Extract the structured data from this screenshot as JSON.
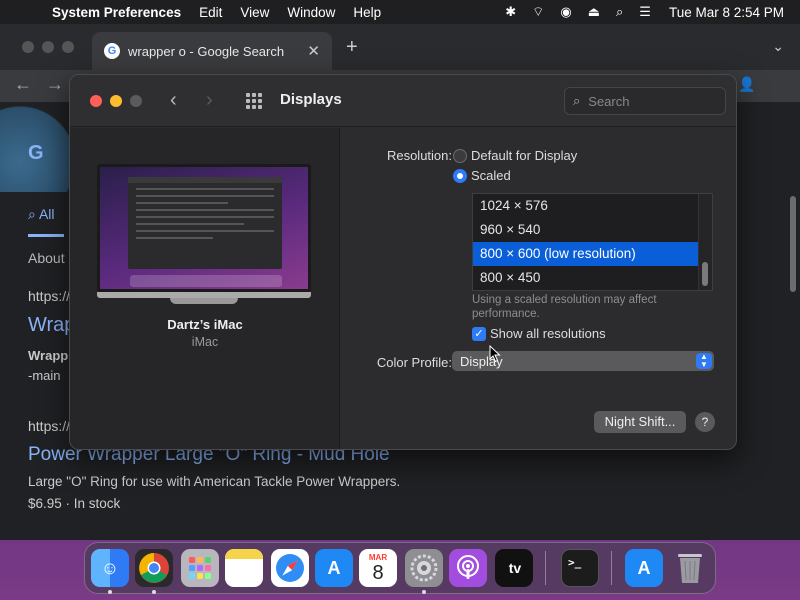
{
  "menubar": {
    "app_name": "System Preferences",
    "items": [
      "Edit",
      "View",
      "Window",
      "Help"
    ],
    "clock": "Tue Mar 8  2:54 PM"
  },
  "browser": {
    "tab_title": "wrapper o - Google Search",
    "results": {
      "all_label": "All",
      "about_label": "About",
      "url1": "https://",
      "title1": "Wrap",
      "snippet1_line1": "Wrapp",
      "snippet1_line2": "-main",
      "url2": "https://",
      "title2": "Power Wrapper Large \"O\" Ring - Mud Hole",
      "snippet2": "Large \"O\" Ring for use with American Tackle Power Wrappers.",
      "price": "$6.95 · In stock"
    }
  },
  "prefs": {
    "title": "Displays",
    "search_placeholder": "Search",
    "device_name": "Dartz’s iMac",
    "device_model": "iMac",
    "resolution_label": "Resolution:",
    "options": {
      "default": "Default for Display",
      "scaled": "Scaled",
      "selected": "scaled"
    },
    "resolutions": [
      "1024 × 576",
      "960 × 540",
      "800 × 600 (low resolution)",
      "800 × 450"
    ],
    "selected_resolution_index": 2,
    "note": "Using a scaled resolution may affect performance.",
    "show_all_label": "Show all resolutions",
    "show_all_checked": true,
    "color_profile_label": "Color Profile:",
    "color_profile_value": "Display",
    "night_shift_label": "Night Shift...",
    "help_label": "?"
  },
  "dock": {
    "items": [
      {
        "name": "finder",
        "color": "#3d8bfd"
      },
      {
        "name": "chrome",
        "color": "#ffffff"
      },
      {
        "name": "launchpad",
        "color": "#b7b7bd"
      },
      {
        "name": "notes",
        "color": "#f5d34a"
      },
      {
        "name": "safari",
        "color": "#2f8df5"
      },
      {
        "name": "app-store",
        "color": "#1e88f5"
      },
      {
        "name": "calendar",
        "color": "#ffffff",
        "month": "MAR",
        "day": "8"
      },
      {
        "name": "system-preferences",
        "color": "#8e8e93"
      },
      {
        "name": "podcasts",
        "color": "#a24de0"
      },
      {
        "name": "apple-tv",
        "color": "#111111",
        "label": "tv"
      },
      {
        "name": "terminal",
        "color": "#1c1c1c",
        "label": ">_"
      },
      {
        "name": "app-store-downloads",
        "color": "#1e88f5"
      },
      {
        "name": "trash",
        "color": "#9a9aa0"
      }
    ]
  }
}
